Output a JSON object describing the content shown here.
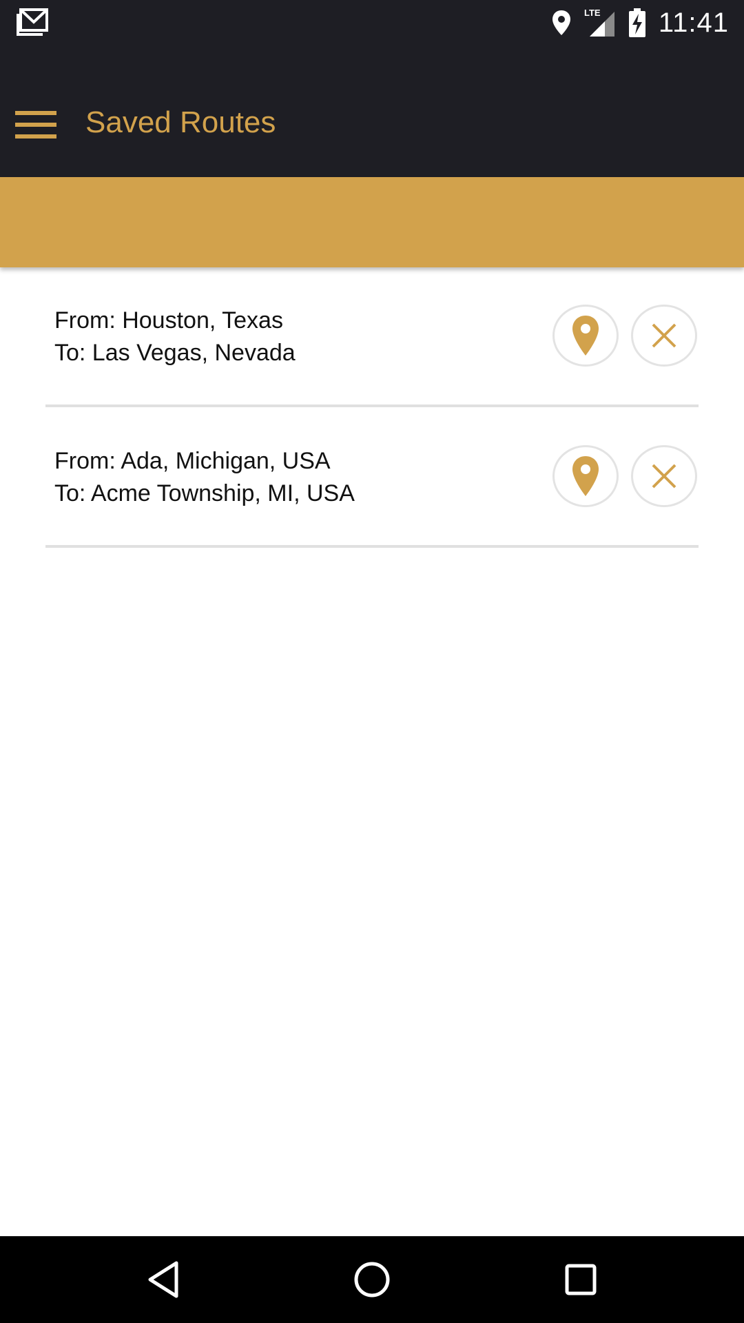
{
  "status_bar": {
    "time": "11:41",
    "icons": [
      "gmail-icon",
      "location-icon",
      "lte-signal-icon",
      "battery-charging-icon"
    ]
  },
  "toolbar": {
    "title": "Saved Routes",
    "menu_icon": "hamburger-menu-icon"
  },
  "routes": [
    {
      "from": "From: Houston, Texas",
      "to": "To: Las Vegas, Nevada",
      "map_icon": "map-pin-icon",
      "delete_icon": "close-icon"
    },
    {
      "from": "From: Ada, Michigan, USA",
      "to": "To: Acme Township, MI, USA",
      "map_icon": "map-pin-icon",
      "delete_icon": "close-icon"
    }
  ],
  "nav_bar": {
    "icons": [
      "back-icon",
      "home-icon",
      "recents-icon"
    ]
  },
  "colors": {
    "accent": "#d2a24c",
    "toolbar_bg": "#1e1e24",
    "nav_bg": "#000000",
    "divider": "#e0e0e0"
  }
}
